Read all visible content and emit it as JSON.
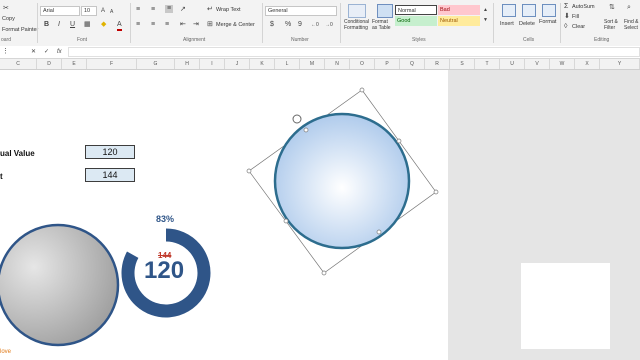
{
  "ribbon": {
    "clipboard": {
      "copy": "Copy",
      "format_painter": "Format Painter",
      "label": "oard"
    },
    "font": {
      "name": "Arial",
      "size": "10",
      "bold": "B",
      "italic": "I",
      "underline": "U",
      "color_glyph": "A",
      "label": "Font"
    },
    "alignment": {
      "wrap_text": "Wrap Text",
      "merge_center": "Merge & Center",
      "label": "Alignment"
    },
    "number": {
      "format": "General",
      "currency": "$",
      "percent": "%",
      "comma": "9",
      "label": "Number"
    },
    "styles": {
      "conditional_formatting": "Conditional Formatting",
      "format_as_table": "Format as Table",
      "normal": "Normal",
      "bad": "Bad",
      "good": "Good",
      "neutral": "Neutral",
      "label": "Styles"
    },
    "cells": {
      "insert": "Insert",
      "delete": "Delete",
      "format": "Format",
      "label": "Cells"
    },
    "editing": {
      "autosum": "AutoSum",
      "fill": "Fill",
      "clear": "Clear",
      "sort_filter": "Sort & Filter",
      "find_select": "Find & Select",
      "label": "Editing"
    }
  },
  "formula_bar": {
    "fx": "fx",
    "value": ""
  },
  "columns": [
    "C",
    "D",
    "E",
    "F",
    "G",
    "H",
    "I",
    "J",
    "K",
    "L",
    "M",
    "N",
    "O",
    "P",
    "Q",
    "R",
    "S",
    "T",
    "U",
    "V",
    "W",
    "X",
    "Y"
  ],
  "sheet": {
    "label_actual": "ual Value",
    "label_target": "t",
    "actual_value": "120",
    "target_value": "144",
    "gauge_percent": "83%",
    "gauge_target": "144",
    "gauge_value": "120",
    "gauge_fill_fraction": 0.83,
    "logo_text": "love"
  },
  "colors": {
    "gauge_blue": "#2f5588",
    "cell_fill": "#dce9f3",
    "bad_fill": "#ffc7ce",
    "good_fill": "#c6efce",
    "neutral_fill": "#ffeb9c",
    "target_red": "#c0392b"
  }
}
